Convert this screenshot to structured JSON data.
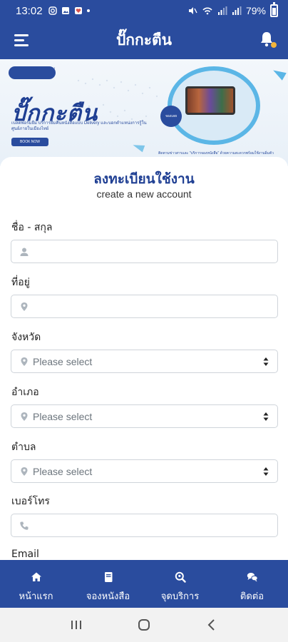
{
  "status_bar": {
    "time": "13:02",
    "battery": "79%",
    "battery_level": 0.79
  },
  "app_bar": {
    "title": "ปั๊กกะตืน",
    "notification_color": "#f2b43a"
  },
  "banner": {
    "logo_text": "Book Delivery",
    "big_title": "ปั๊กกะตืน",
    "description": "เบลตฟอร์มยืม บริการยืมคืนหนังสือแบบ Delivery และบอกตำแหน่งการรู้ในศูนย์ภายในเมืองไทย์",
    "button_label": "BOOK NOW",
    "badge_text": "จองเลย",
    "footer_note": "ติดตามข่าวสารและ \"บริการจองหนังสือ\" ด้วยความสะดวกพร้อมใช้งานอิ่มตัว"
  },
  "form": {
    "title": "ลงทะเบียนใช้งาน",
    "subtitle": "create a new account",
    "fields": [
      {
        "label": "ชื่อ - สกุล",
        "icon": "user-icon",
        "placeholder": "",
        "type": "text"
      },
      {
        "label": "ที่อยู่",
        "icon": "map-marker-icon",
        "placeholder": "",
        "type": "text"
      },
      {
        "label": "จังหวัด",
        "icon": "map-marker-icon",
        "placeholder": "Please select",
        "type": "select"
      },
      {
        "label": "อำเภอ",
        "icon": "map-marker-icon",
        "placeholder": "Please select",
        "type": "select"
      },
      {
        "label": "ตำบล",
        "icon": "map-marker-icon",
        "placeholder": "Please select",
        "type": "select"
      },
      {
        "label": "เบอร์โทร",
        "icon": "phone-icon",
        "placeholder": "",
        "type": "text"
      },
      {
        "label": "Email",
        "icon": "",
        "placeholder": "",
        "type": "text"
      }
    ]
  },
  "bottom_nav": {
    "items": [
      {
        "label": "หน้าแรก",
        "icon": "home-icon"
      },
      {
        "label": "จองหนังสือ",
        "icon": "book-icon"
      },
      {
        "label": "จุดบริการ",
        "icon": "search-location-icon"
      },
      {
        "label": "ติดต่อ",
        "icon": "chat-icon"
      }
    ]
  },
  "colors": {
    "primary": "#2a4c9e",
    "accent": "#5bb6e6",
    "text": "#222222"
  }
}
